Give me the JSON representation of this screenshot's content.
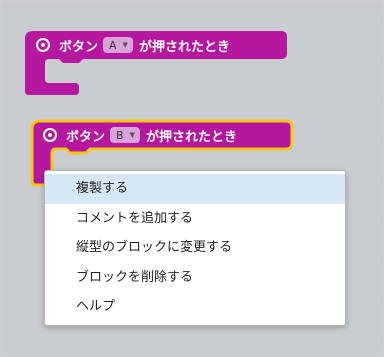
{
  "blocks": [
    {
      "label_prefix": "ボタン",
      "dropdown_value": "A",
      "label_suffix": "が押されたとき",
      "selected": false
    },
    {
      "label_prefix": "ボタン",
      "dropdown_value": "B",
      "label_suffix": "が押されたとき",
      "selected": true
    }
  ],
  "context_menu": {
    "items": [
      {
        "label": "複製する",
        "highlighted": true
      },
      {
        "label": "コメントを追加する",
        "highlighted": false
      },
      {
        "label": "縦型のブロックに変更する",
        "highlighted": false
      },
      {
        "label": "ブロックを削除する",
        "highlighted": false
      },
      {
        "label": "ヘルプ",
        "highlighted": false
      }
    ]
  },
  "colors": {
    "block": "#b5179e",
    "block_selected_outline": "#f5c518",
    "dropdown_bg": "#d9a3da",
    "menu_highlight": "#d6e7f6",
    "workspace_bg": "#e9eef2"
  },
  "icons": {
    "event_icon": "radio-target-icon",
    "dropdown_caret": "caret-down-icon"
  }
}
